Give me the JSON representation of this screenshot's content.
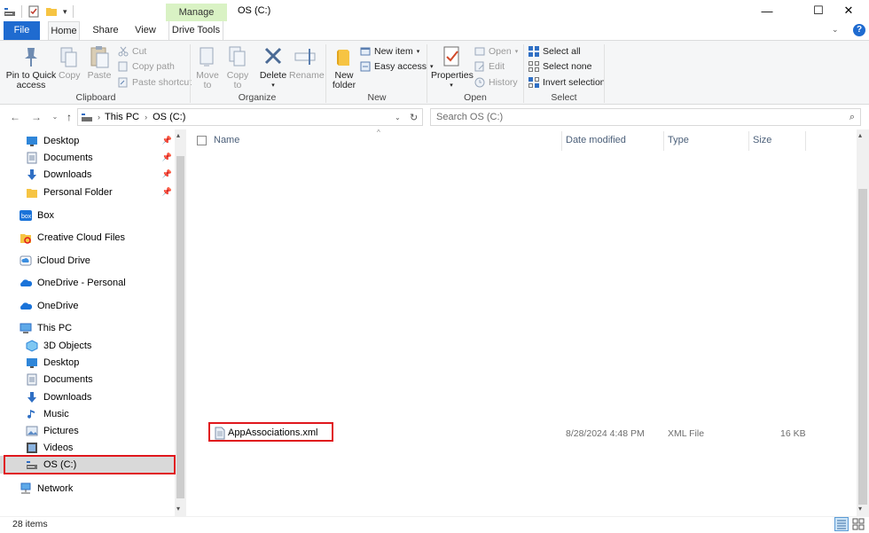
{
  "window": {
    "title": "OS (C:)",
    "contextual_tab_group": "Manage",
    "minimize": "—",
    "maximize": "☐",
    "close": "✕"
  },
  "tabs": [
    "File",
    "Home",
    "Share",
    "View",
    "Drive Tools"
  ],
  "ribbon": {
    "clipboard": {
      "pin_label": "Pin to Quick access",
      "copy_label": "Copy",
      "paste_label": "Paste",
      "cut_label": "Cut",
      "copy_path_label": "Copy path",
      "paste_shortcut_label": "Paste shortcut",
      "group_label": "Clipboard"
    },
    "organize": {
      "move_to_label": "Move to",
      "copy_to_label": "Copy to",
      "delete_label": "Delete",
      "rename_label": "Rename",
      "group_label": "Organize"
    },
    "new": {
      "new_folder_label": "New folder",
      "new_item_label": "New item",
      "easy_access_label": "Easy access",
      "group_label": "New"
    },
    "open": {
      "properties_label": "Properties",
      "open_label": "Open",
      "edit_label": "Edit",
      "history_label": "History",
      "group_label": "Open"
    },
    "select": {
      "select_all_label": "Select all",
      "select_none_label": "Select none",
      "invert_selection_label": "Invert selection",
      "group_label": "Select"
    }
  },
  "address": {
    "crumb1": "This PC",
    "crumb2": "OS (C:)",
    "search_placeholder": "Search OS (C:)"
  },
  "nav_pane": {
    "items": [
      {
        "label": "Desktop",
        "icon": "desktop-icon",
        "pinned": true
      },
      {
        "label": "Documents",
        "icon": "documents-icon",
        "pinned": true
      },
      {
        "label": "Downloads",
        "icon": "downloads-icon",
        "pinned": true
      },
      {
        "label": "Personal Folder",
        "icon": "folder-icon",
        "pinned": true
      },
      {
        "label": "Box",
        "icon": "box-icon"
      },
      {
        "label": "Creative Cloud Files",
        "icon": "creative-cloud-icon"
      },
      {
        "label": "iCloud Drive",
        "icon": "icloud-icon"
      },
      {
        "label": "OneDrive - Personal",
        "icon": "onedrive-icon"
      },
      {
        "label": "OneDrive",
        "icon": "onedrive-icon"
      },
      {
        "label": "This PC",
        "icon": "this-pc-icon"
      },
      {
        "label": "3D Objects",
        "icon": "3d-objects-icon"
      },
      {
        "label": "Desktop",
        "icon": "desktop-icon"
      },
      {
        "label": "Documents",
        "icon": "documents-icon"
      },
      {
        "label": "Downloads",
        "icon": "downloads-icon"
      },
      {
        "label": "Music",
        "icon": "music-icon"
      },
      {
        "label": "Pictures",
        "icon": "pictures-icon"
      },
      {
        "label": "Videos",
        "icon": "videos-icon"
      },
      {
        "label": "OS (C:)",
        "icon": "drive-icon",
        "selected": true
      },
      {
        "label": "Network",
        "icon": "network-icon"
      }
    ]
  },
  "columns": {
    "name": "Name",
    "date_modified": "Date modified",
    "type": "Type",
    "size": "Size"
  },
  "files": [
    {
      "name": "AppAssociations.xml",
      "date_modified": "8/28/2024 4:48 PM",
      "type": "XML File",
      "size": "16 KB"
    }
  ],
  "status": {
    "item_count": "28 items"
  },
  "colors": {
    "file_tab": "#1f6bd0",
    "manage_tab": "#d9f2c4",
    "highlight_box": "#e0171d",
    "selected_nav": "#d9d9d9"
  }
}
